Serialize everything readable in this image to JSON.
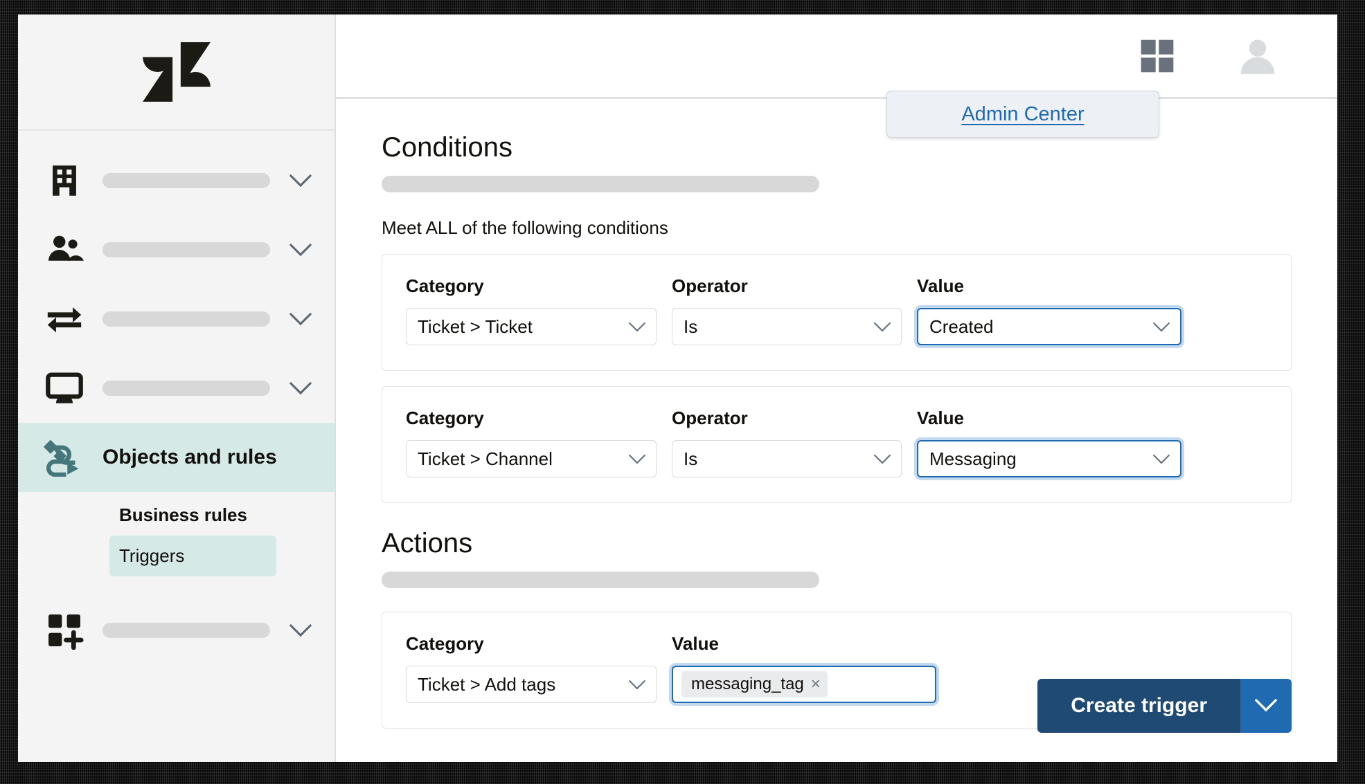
{
  "app": {
    "brand": "zendesk-logo"
  },
  "topbar": {
    "products_icon": "grid-apps-icon",
    "avatar_icon": "user-avatar-icon",
    "admin_popup": {
      "label": "Admin Center"
    }
  },
  "sidebar": {
    "items": [
      {
        "icon": "building-icon",
        "label": "",
        "placeholder_bar": true,
        "expandable": true,
        "active": false
      },
      {
        "icon": "people-icon",
        "label": "",
        "placeholder_bar": true,
        "expandable": true,
        "active": false
      },
      {
        "icon": "arrows-exchange-icon",
        "label": "",
        "placeholder_bar": true,
        "expandable": true,
        "active": false
      },
      {
        "icon": "monitor-icon",
        "label": "",
        "placeholder_bar": true,
        "expandable": true,
        "active": false
      },
      {
        "icon": "objects-rules-icon",
        "label": "Objects and rules",
        "placeholder_bar": false,
        "expandable": false,
        "active": true
      },
      {
        "icon": "apps-add-icon",
        "label": "",
        "placeholder_bar": true,
        "expandable": true,
        "active": false
      }
    ],
    "subnav": {
      "heading": "Business rules",
      "items": [
        {
          "label": "Triggers",
          "selected": true
        }
      ]
    }
  },
  "main": {
    "conditions": {
      "title": "Conditions",
      "meet_text": "Meet ALL of the following conditions",
      "rows": [
        {
          "category_label": "Category",
          "category_value": "Ticket > Ticket",
          "operator_label": "Operator",
          "operator_value": "Is",
          "value_label": "Value",
          "value_value": "Created",
          "value_focused": true
        },
        {
          "category_label": "Category",
          "category_value": "Ticket > Channel",
          "operator_label": "Operator",
          "operator_value": "Is",
          "value_label": "Value",
          "value_value": "Messaging",
          "value_focused": true
        }
      ]
    },
    "actions": {
      "title": "Actions",
      "rows": [
        {
          "category_label": "Category",
          "category_value": "Ticket > Add tags",
          "value_label": "Value",
          "tags": [
            {
              "label": "messaging_tag",
              "remove": "×"
            }
          ]
        }
      ]
    },
    "footer": {
      "create_label": "Create trigger",
      "split_icon": "chevron-down-icon"
    }
  },
  "colors": {
    "accent_teal": "#d5e9e6",
    "link_blue": "#1f6ab0",
    "focus_blue": "#1f6ab0",
    "focus_ring": "#c3d9ef",
    "primary_button": "#1f4a73",
    "split_button": "#1f6ab0",
    "skeleton": "#d8d8d8",
    "sidebar_bg": "#f4f4f4"
  }
}
